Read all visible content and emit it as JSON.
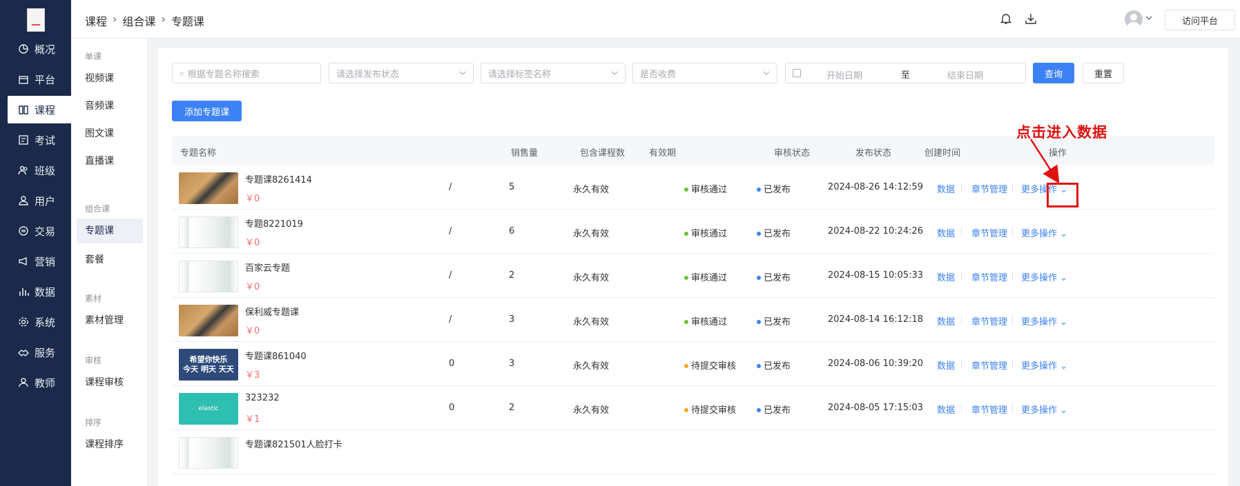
{
  "sidebar": {
    "items": [
      {
        "label": "概况",
        "icon": "clock-pie-icon"
      },
      {
        "label": "平台",
        "icon": "store-icon"
      },
      {
        "label": "课程",
        "icon": "book-icon"
      },
      {
        "label": "考试",
        "icon": "exam-icon"
      },
      {
        "label": "班级",
        "icon": "people-icon"
      },
      {
        "label": "用户",
        "icon": "user-icon"
      },
      {
        "label": "交易",
        "icon": "exchange-icon"
      },
      {
        "label": "营销",
        "icon": "megaphone-icon"
      },
      {
        "label": "数据",
        "icon": "bar-chart-icon"
      },
      {
        "label": "系统",
        "icon": "gear-icon"
      },
      {
        "label": "服务",
        "icon": "handshake-icon"
      },
      {
        "label": "教师",
        "icon": "teacher-icon"
      }
    ],
    "active": "课程"
  },
  "submenu": {
    "group_single": "单课",
    "video": "视频课",
    "audio": "音频课",
    "article": "图文课",
    "live": "直播课",
    "group_combo": "组合课",
    "topic": "专题课",
    "package": "套餐",
    "group_material": "素材",
    "material_manage": "素材管理",
    "group_review": "审核",
    "course_review": "课程审核",
    "group_sort": "排序",
    "course_sort": "课程排序"
  },
  "header": {
    "breadcrumb": [
      "课程",
      "组合课",
      "专题课"
    ],
    "visit_button": "访问平台"
  },
  "filters": {
    "search_placeholder": "根据专题名称搜索",
    "publish_status_placeholder": "请选择发布状态",
    "tag_placeholder": "请选择标签名称",
    "charge_placeholder": "是否收费",
    "start_date_placeholder": "开始日期",
    "date_separator": "至",
    "end_date_placeholder": "结束日期",
    "query_button": "查询",
    "reset_button": "重置"
  },
  "add_button": "添加专题课",
  "table": {
    "headers": [
      "专题名称",
      "销售量",
      "包含课程数",
      "有效期",
      "审核状态",
      "发布状态",
      "创建时间",
      "操作"
    ],
    "rows": [
      {
        "title": "专题课8261414",
        "price": "￥0",
        "sales": "/",
        "courses": "5",
        "validity": "永久有效",
        "review": "审核通过",
        "review_color": "#67c23a",
        "publish": "已发布",
        "created": "2024-08-26 14:12:59",
        "thumb": "court"
      },
      {
        "title": "专题8221019",
        "price": "￥0",
        "sales": "/",
        "courses": "6",
        "validity": "永久有效",
        "review": "审核通过",
        "review_color": "#67c23a",
        "publish": "已发布",
        "created": "2024-08-22 10:24:26",
        "thumb": "blank"
      },
      {
        "title": "百家云专题",
        "price": "￥0",
        "sales": "/",
        "courses": "2",
        "validity": "永久有效",
        "review": "审核通过",
        "review_color": "#67c23a",
        "publish": "已发布",
        "created": "2024-08-15 10:05:33",
        "thumb": "blank"
      },
      {
        "title": "保利威专题课",
        "price": "￥0",
        "sales": "/",
        "courses": "3",
        "validity": "永久有效",
        "review": "审核通过",
        "review_color": "#67c23a",
        "publish": "已发布",
        "created": "2024-08-14 16:12:18",
        "thumb": "court"
      },
      {
        "title": "专题课861040",
        "price": "￥3",
        "sales": "0",
        "courses": "3",
        "validity": "永久有效",
        "review": "待提交审核",
        "review_color": "#f5a623",
        "publish": "已发布",
        "created": "2024-08-06 10:39:20",
        "thumb": "blue",
        "thumb_text1": "希望你快乐",
        "thumb_text2": "今天 明天 天天"
      },
      {
        "title": "323232",
        "price": "￥1",
        "sales": "0",
        "courses": "2",
        "validity": "永久有效",
        "review": "待提交审核",
        "review_color": "#f5a623",
        "publish": "已发布",
        "created": "2024-08-05 17:15:03",
        "thumb": "teal",
        "thumb_text1": "elastic"
      },
      {
        "title": "专题课821501人脸打卡",
        "thumb": "blank"
      }
    ],
    "publish_color": "#3c82f6",
    "action_data": "数据",
    "action_chapters": "章节管理",
    "action_more": "更多操作"
  },
  "annotation": {
    "text": "点击进入数据",
    "color": "#e01010"
  }
}
